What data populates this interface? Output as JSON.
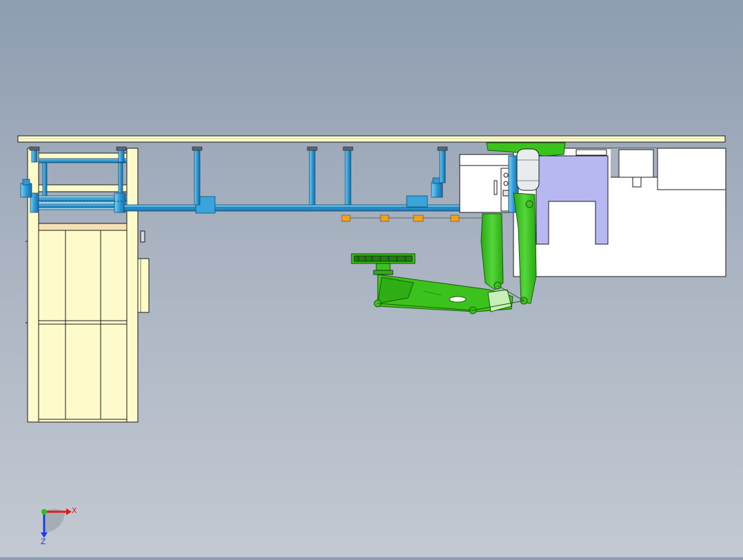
{
  "view": {
    "colors": {
      "background_top": "#8e9db1",
      "background_bottom": "#c3c9d2",
      "frame_yellow": "#fdfbc9",
      "conveyor_blue": "#3aa5dc",
      "robot_green": "#3cc21c",
      "enclosure_lavender": "#b7b7f2",
      "cabinet_white": "#ffffff",
      "pallet_orange": "#f0a21e",
      "outline": "#1a1a1a"
    }
  },
  "triad": {
    "x_label": "X",
    "z_label": "Z",
    "icons": [
      "x-axis-arrow-icon",
      "z-axis-arrow-icon",
      "y-axis-dot-icon"
    ]
  }
}
